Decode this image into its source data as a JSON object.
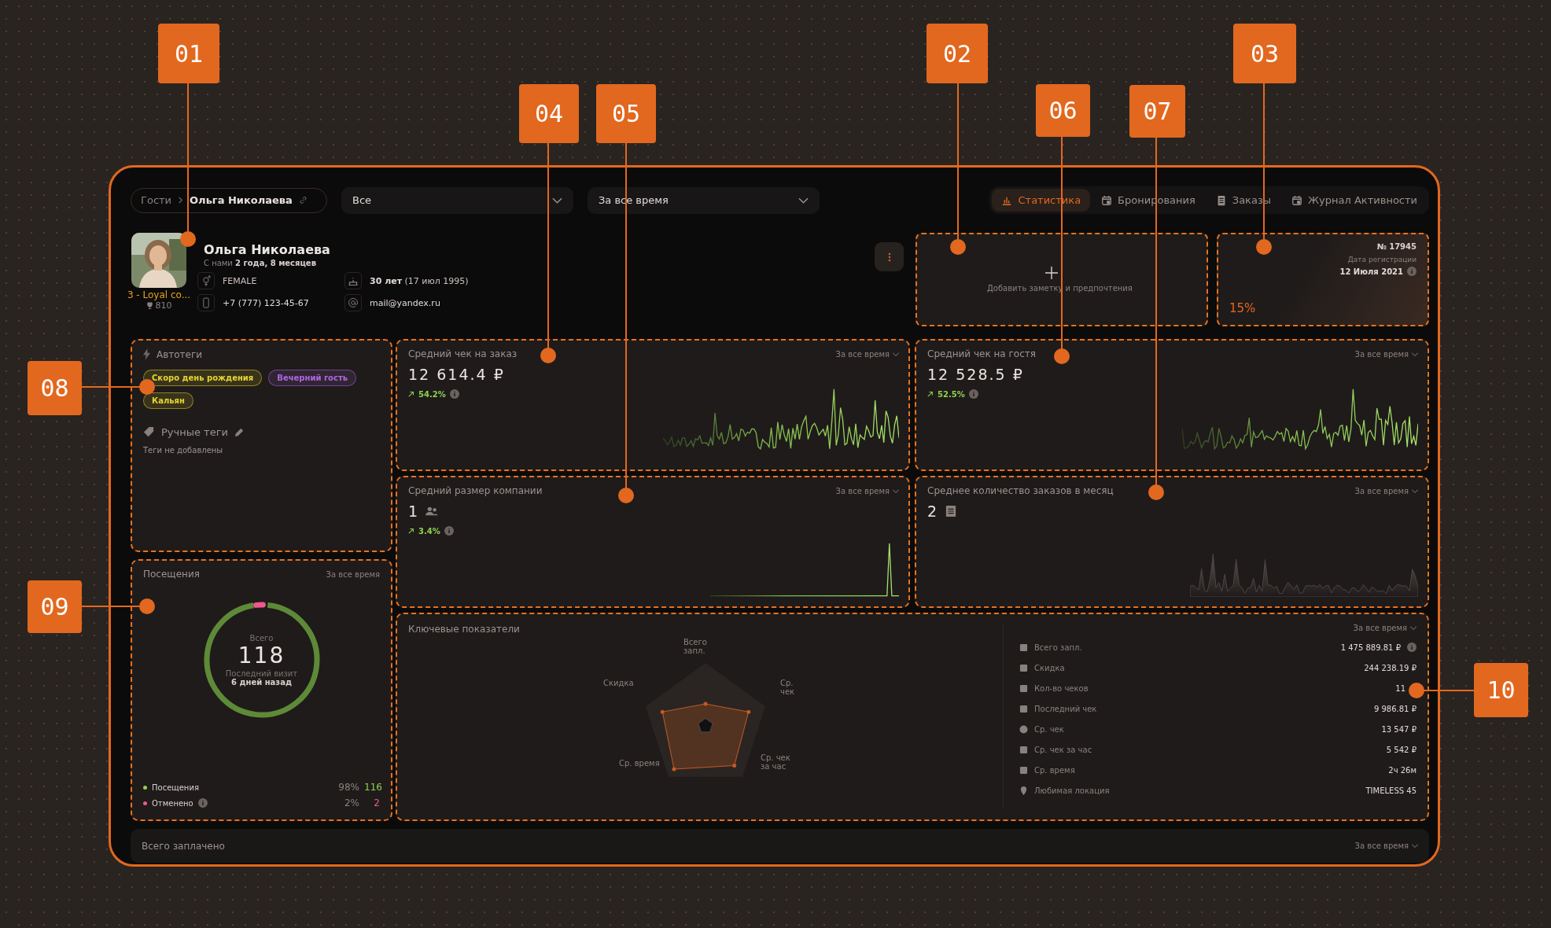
{
  "callouts": [
    {
      "number": "01"
    },
    {
      "number": "02"
    },
    {
      "number": "03"
    },
    {
      "number": "04"
    },
    {
      "number": "05"
    },
    {
      "number": "06"
    },
    {
      "number": "07"
    },
    {
      "number": "08"
    },
    {
      "number": "09"
    },
    {
      "number": "10"
    }
  ],
  "breadcrumb": {
    "items": [
      "Гости",
      "Ольга Николаева"
    ]
  },
  "filters": [
    {
      "value": "Все"
    },
    {
      "value": "За все время"
    }
  ],
  "tabs": [
    {
      "label": "Статистика",
      "selected": true
    },
    {
      "label": "Бронирования",
      "selected": false
    },
    {
      "label": "Заказы",
      "selected": false
    },
    {
      "label": "Журнал Активности",
      "selected": false
    }
  ],
  "profile": {
    "name": "Ольга Николаева",
    "tenure": "С нами **2 года, 8 месяцев**",
    "loyalty": "3 - Loyal co...",
    "points": "810",
    "gender": "FEMALE",
    "age": "**30 лет** (17 июл 1995)",
    "phone": "+7 (777) 123-45-67",
    "email": "mail@yandex.ru"
  },
  "note": {
    "label": "Добавить заметку и предпочтения"
  },
  "loyalty_card": {
    "number": "№ 17945",
    "reg_label": "Дата регистрации",
    "reg_date": "12 Июля 2021",
    "discount": "15%"
  },
  "autotags": {
    "title": "Автотеги",
    "tags": [
      {
        "label": "Скоро день рождения",
        "color": "#e6d52e"
      },
      {
        "label": "Вечерний гость",
        "color": "#b066e0"
      },
      {
        "label": "Кальян",
        "color": "#e6d52e"
      }
    ]
  },
  "manual_tags": {
    "title": "Ручные теги",
    "empty": "Теги не добавлены"
  },
  "visits": {
    "title": "Посещения",
    "period": "За все время",
    "total_label": "Всего",
    "total": "118",
    "last_label": "Последний визит",
    "last": "6 дней назад",
    "level": 0.98,
    "legend": [
      {
        "label": "Посещения",
        "percent": "98%",
        "count": "116",
        "color": "#8fd14f"
      },
      {
        "label": "Отменено",
        "percent": "2%",
        "count": "2",
        "color": "#f0588c"
      }
    ]
  },
  "metrics": [
    {
      "kind": "line",
      "title": "Средний чек на заказ",
      "period": "За все время",
      "value": "12 614.4 ₽",
      "change": "54.2%"
    },
    {
      "kind": "line",
      "title": "Средний чек на гостя",
      "period": "За все время",
      "value": "12 528.5 ₽",
      "change": "52.5%"
    },
    {
      "kind": "spike",
      "title": "Средний размер компании",
      "period": "За все время",
      "value": "1",
      "change": "3.4%"
    },
    {
      "kind": "area",
      "title": "Среднее количество заказов в месяц",
      "period": "За все время",
      "value": "2"
    }
  ],
  "key_indicators": {
    "title": "Ключевые показатели",
    "period": "За все время",
    "radar_labels": [
      "Всего запл.",
      "Скидка",
      "Ср. чек",
      "Ср. время",
      "Ср. чек за час"
    ],
    "rows": [
      {
        "label": "Всего запл.",
        "value": "1 475 889.81 ₽",
        "info": true
      },
      {
        "label": "Скидка",
        "value": "244 238.19 ₽",
        "info": false
      },
      {
        "label": "Кол-во чеков",
        "value": "11",
        "info": false
      },
      {
        "label": "Последний чек",
        "value": "9 986.81 ₽",
        "info": false
      },
      {
        "label": "Ср. чек",
        "value": "13 547 ₽",
        "info": false
      },
      {
        "label": "Ср. чек за час",
        "value": "5 542 ₽",
        "info": false
      },
      {
        "label": "Ср. время",
        "value": "2ч 26м",
        "info": false
      },
      {
        "label": "Любимая локация",
        "value": "TIMELESS 45",
        "info": false
      }
    ]
  },
  "total_paid": {
    "title": "Всего заплачено",
    "period": "За все время"
  }
}
